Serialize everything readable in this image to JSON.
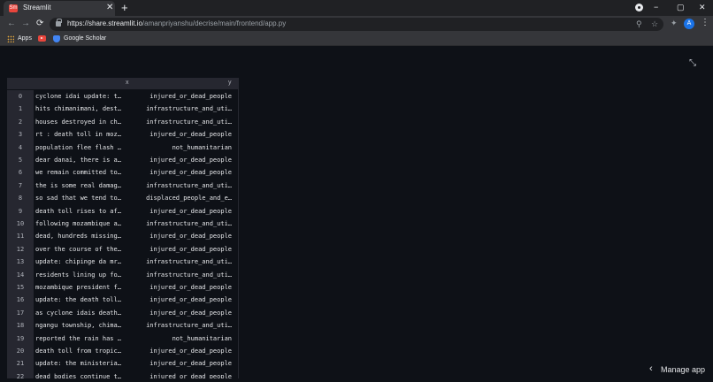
{
  "browser": {
    "tab_title": "Streamlit",
    "tab_favicon": "Sm",
    "url_host": "https://share.streamlit.io",
    "url_path": "/amanpriyanshu/decrise/main/frontend/app.py",
    "bookmarks": [
      "Apps",
      "Google Scholar"
    ],
    "profile_initial": "A",
    "icons": {
      "back": "←",
      "forward": "→",
      "reload": "⟳",
      "new_tab": "+",
      "close": "✕",
      "minimize": "−",
      "maximize": "▢",
      "window_close": "✕",
      "zoom": "⚲",
      "star": "☆",
      "extensions": "✦",
      "menu": "⋮"
    }
  },
  "dataframe": {
    "columns": [
      "x",
      "y"
    ],
    "rows": [
      {
        "i": "0",
        "x": "cyclone idai update: t…",
        "y": "injured_or_dead_people"
      },
      {
        "i": "1",
        "x": "hits chimanimani, dest…",
        "y": "infrastructure_and_uti…"
      },
      {
        "i": "2",
        "x": "houses destroyed in ch…",
        "y": "infrastructure_and_uti…"
      },
      {
        "i": "3",
        "x": "rt : death toll in moz…",
        "y": "injured_or_dead_people"
      },
      {
        "i": "4",
        "x": "population flee flash …",
        "y": "not_humanitarian"
      },
      {
        "i": "5",
        "x": "dear danai, there is a…",
        "y": "injured_or_dead_people"
      },
      {
        "i": "6",
        "x": "we remain committed to…",
        "y": "injured_or_dead_people"
      },
      {
        "i": "7",
        "x": "the is some real damag…",
        "y": "infrastructure_and_uti…"
      },
      {
        "i": "8",
        "x": "so sad that we tend to…",
        "y": "displaced_people_and_e…"
      },
      {
        "i": "9",
        "x": "death toll rises to af…",
        "y": "injured_or_dead_people"
      },
      {
        "i": "10",
        "x": "following mozambique a…",
        "y": "infrastructure_and_uti…"
      },
      {
        "i": "11",
        "x": "dead, hundreds missing…",
        "y": "injured_or_dead_people"
      },
      {
        "i": "12",
        "x": "over the course of the…",
        "y": "injured_or_dead_people"
      },
      {
        "i": "13",
        "x": "update: chipinge da mr…",
        "y": "infrastructure_and_uti…"
      },
      {
        "i": "14",
        "x": "residents lining up fo…",
        "y": "infrastructure_and_uti…"
      },
      {
        "i": "15",
        "x": "mozambique president f…",
        "y": "injured_or_dead_people"
      },
      {
        "i": "16",
        "x": "update: the death toll…",
        "y": "injured_or_dead_people"
      },
      {
        "i": "17",
        "x": "as cyclone idais death…",
        "y": "injured_or_dead_people"
      },
      {
        "i": "18",
        "x": "ngangu township, chima…",
        "y": "infrastructure_and_uti…"
      },
      {
        "i": "19",
        "x": "reported the rain has …",
        "y": "not_humanitarian"
      },
      {
        "i": "20",
        "x": "death toll from tropic…",
        "y": "injured_or_dead_people"
      },
      {
        "i": "21",
        "x": "update: the ministeria…",
        "y": "injured_or_dead_people"
      },
      {
        "i": "22",
        "x": "dead bodies continue t…",
        "y": "injured_or_dead_people"
      }
    ]
  },
  "footer": {
    "manage_app": "Manage app",
    "chevron": "‹"
  },
  "colors": {
    "background": "#0e1117",
    "header": "#262730",
    "text": "#e6e7ea",
    "browser_chrome": "#35363a"
  }
}
